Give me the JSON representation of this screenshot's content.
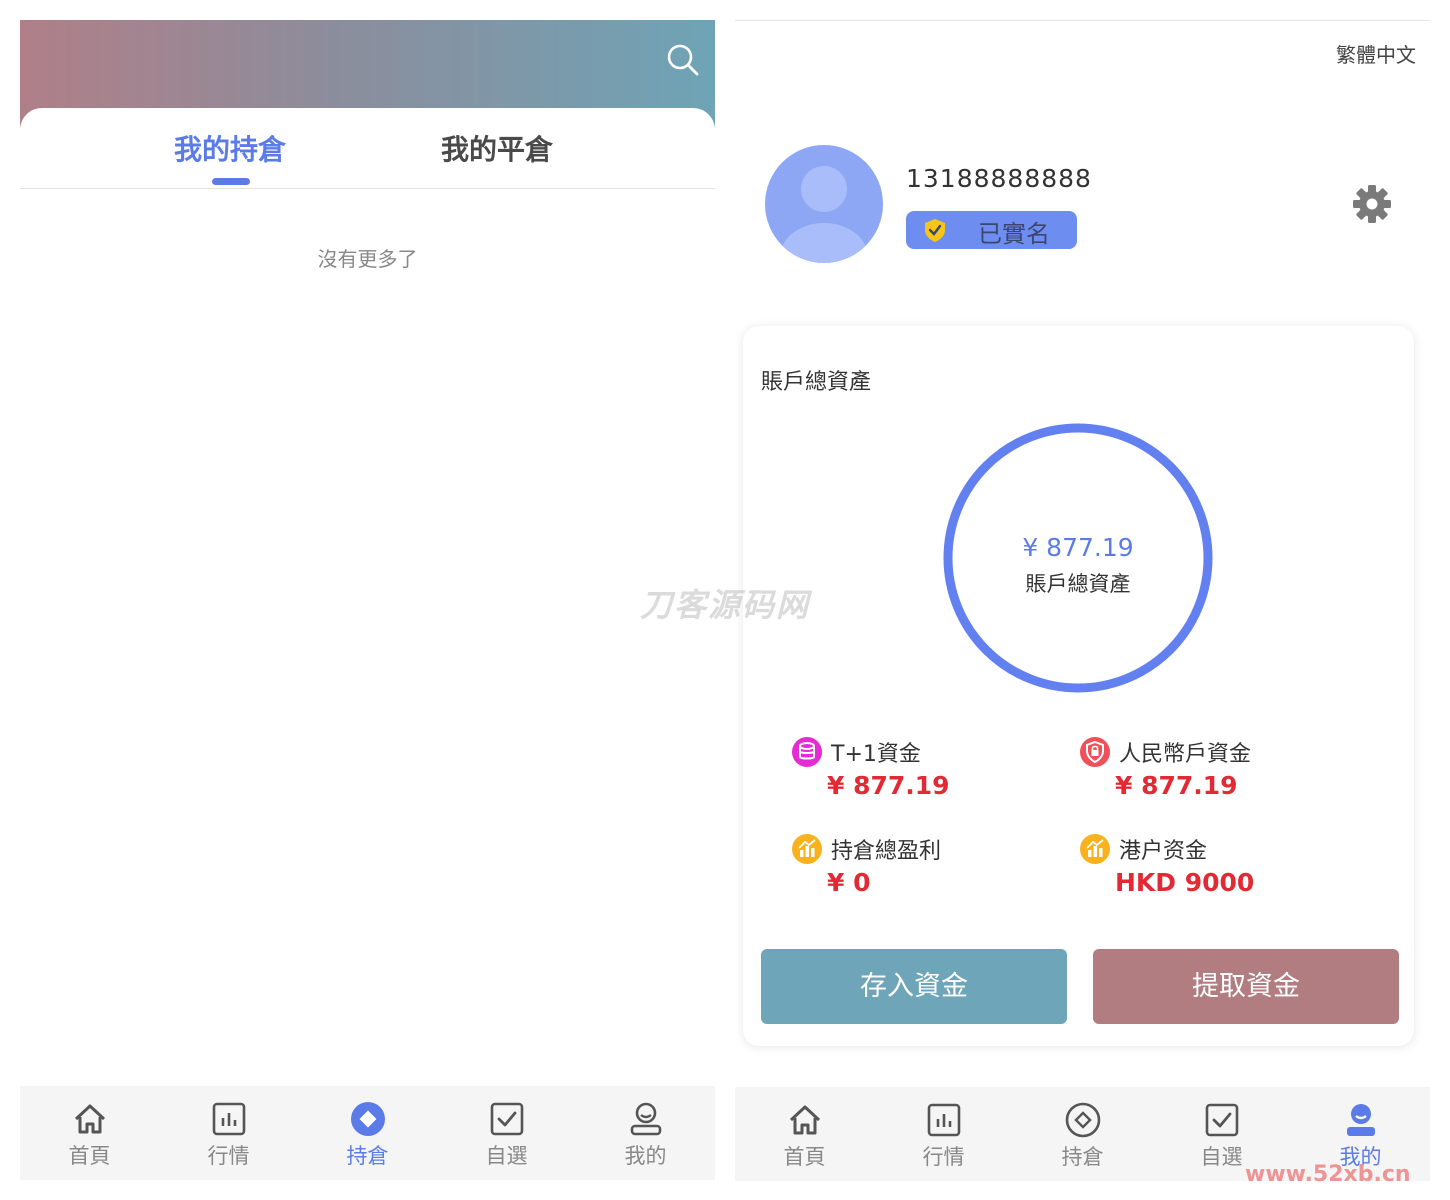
{
  "left": {
    "tabs": [
      {
        "label": "我的持倉",
        "active": true
      },
      {
        "label": "我的平倉",
        "active": false
      }
    ],
    "empty_text": "沒有更多了",
    "nav": [
      {
        "label": "首頁",
        "icon": "home-icon"
      },
      {
        "label": "行情",
        "icon": "chart-icon"
      },
      {
        "label": "持倉",
        "icon": "holdings-icon",
        "active": true
      },
      {
        "label": "自選",
        "icon": "watchlist-icon"
      },
      {
        "label": "我的",
        "icon": "profile-icon"
      }
    ]
  },
  "right": {
    "language": "繁體中文",
    "user": {
      "phone": "13188888888",
      "verified_label": "已實名"
    },
    "assets": {
      "title": "賬戶總資產",
      "total_value": "¥ 877.19",
      "total_label": "賬戶總資產",
      "funds": [
        {
          "name": "T+1資金",
          "value": "¥ 877.19",
          "icon": "database-icon",
          "color": "#e52bd4"
        },
        {
          "name": "人民幣戶資金",
          "value": "¥ 877.19",
          "icon": "shield-lock-icon",
          "color": "#f0505a"
        },
        {
          "name": "持倉總盈利",
          "value": "¥ 0",
          "icon": "bar-chart-icon",
          "color": "#f7b21d"
        },
        {
          "name": "港户资金",
          "value": "HKD 9000",
          "icon": "bar-chart-icon",
          "color": "#f7b21d"
        }
      ]
    },
    "actions": {
      "deposit": "存入資金",
      "withdraw": "提取資金"
    },
    "nav": [
      {
        "label": "首頁",
        "icon": "home-icon"
      },
      {
        "label": "行情",
        "icon": "chart-icon"
      },
      {
        "label": "持倉",
        "icon": "holdings-icon"
      },
      {
        "label": "自選",
        "icon": "watchlist-icon"
      },
      {
        "label": "我的",
        "icon": "profile-icon",
        "active": true
      }
    ]
  },
  "colors": {
    "accent": "#5b7be8",
    "value_red": "#e22a35",
    "deposit": "#6fa5b9",
    "withdraw": "#b17d80"
  },
  "watermarks": {
    "center": "刀客源码网",
    "corner": "www.52xb.cn"
  }
}
